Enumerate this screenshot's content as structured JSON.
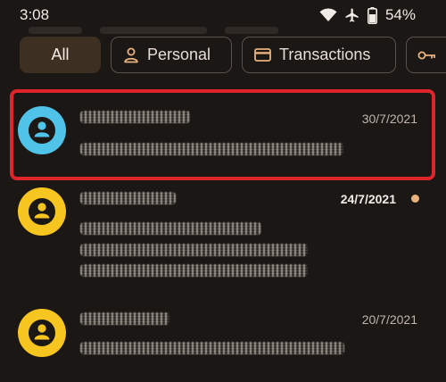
{
  "status_bar": {
    "time": "3:08",
    "battery_percent": "54%",
    "icons": [
      "wifi-icon",
      "airplane-icon",
      "battery-icon"
    ]
  },
  "filters": [
    {
      "label": "All",
      "selected": true
    },
    {
      "label": "Personal",
      "icon": "person-icon"
    },
    {
      "label": "Transactions",
      "icon": "card-icon"
    },
    {
      "label": "",
      "icon": "key-icon"
    }
  ],
  "threads": [
    {
      "date": "30/7/2021",
      "unread": false,
      "avatar_color": "#4fc3e8",
      "redacted": true,
      "highlighted": true
    },
    {
      "date": "24/7/2021",
      "unread": true,
      "avatar_color": "#f6c51f",
      "redacted": true
    },
    {
      "date": "20/7/2021",
      "unread": false,
      "avatar_color": "#f6c51f",
      "redacted": true
    }
  ],
  "colors": {
    "background": "#1b1715",
    "selected_chip": "#3e2f23",
    "unread_dot": "#e9b27c",
    "highlight": "#e0242c"
  }
}
